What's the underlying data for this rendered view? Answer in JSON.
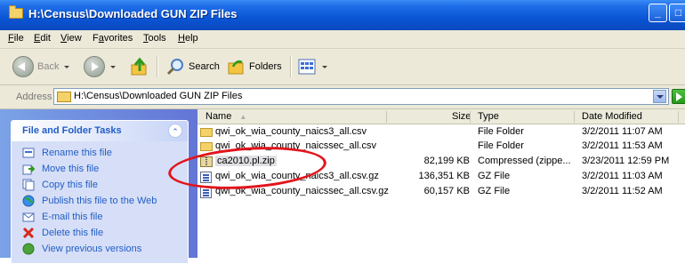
{
  "window": {
    "title": "H:\\Census\\Downloaded GUN ZIP Files",
    "min_label": "_",
    "max_label": "□"
  },
  "menu": [
    {
      "key": "F",
      "rest": "ile"
    },
    {
      "key": "E",
      "rest": "dit"
    },
    {
      "key": "V",
      "rest": "iew"
    },
    {
      "pre": "F",
      "key": "a",
      "rest": "vorites"
    },
    {
      "key": "T",
      "rest": "ools"
    },
    {
      "key": "H",
      "rest": "elp"
    }
  ],
  "toolbar": {
    "back_label": "Back",
    "search_label": "Search",
    "folders_label": "Folders"
  },
  "address": {
    "label": "Address",
    "path": "H:\\Census\\Downloaded GUN ZIP Files"
  },
  "tasks": {
    "title": "File and Folder Tasks",
    "collapse_glyph": "⌃",
    "items": [
      {
        "label": "Rename this file",
        "icon": "rename-icon"
      },
      {
        "label": "Move this file",
        "icon": "move-icon"
      },
      {
        "label": "Copy this file",
        "icon": "copy-icon"
      },
      {
        "label": "Publish this file to the Web",
        "icon": "globe-icon"
      },
      {
        "label": "E-mail this file",
        "icon": "email-icon"
      },
      {
        "label": "Delete this file",
        "icon": "delete-icon"
      },
      {
        "label": "View previous versions",
        "icon": "versions-icon"
      }
    ]
  },
  "columns": {
    "name": "Name",
    "sort_glyph": "▲",
    "size": "Size",
    "type": "Type",
    "date": "Date Modified"
  },
  "files": [
    {
      "name": "qwi_ok_wia_county_naics3_all.csv",
      "size": "",
      "type": "File Folder",
      "date": "3/2/2011 11:07 AM",
      "icon": "folder-icon"
    },
    {
      "name": "qwi_ok_wia_county_naicssec_all.csv",
      "size": "",
      "type": "File Folder",
      "date": "3/2/2011 11:53 AM",
      "icon": "folder-icon"
    },
    {
      "name": "ca2010.pl.zip",
      "size": "82,199 KB",
      "type": "Compressed (zippe...",
      "date": "3/23/2011 12:59 PM",
      "icon": "zip-icon"
    },
    {
      "name": "qwi_ok_wia_county_naics3_all.csv.gz",
      "size": "136,351 KB",
      "type": "GZ File",
      "date": "3/2/2011 11:03 AM",
      "icon": "gz-file-icon"
    },
    {
      "name": "qwi_ok_wia_county_naicssec_all.csv.gz",
      "size": "60,157 KB",
      "type": "GZ File",
      "date": "3/2/2011 11:52 AM",
      "icon": "gz-file-icon"
    }
  ],
  "colors": {
    "highlight_circle": "#e2141b",
    "title_bar": "#0a55d5"
  }
}
